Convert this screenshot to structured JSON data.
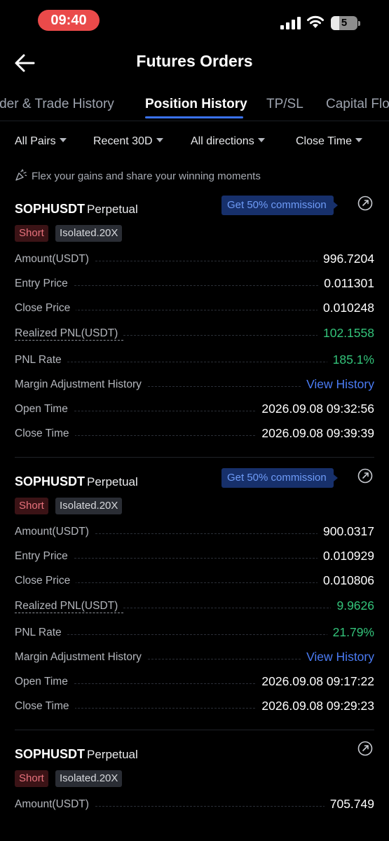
{
  "status_bar": {
    "time": "09:40",
    "battery": "5"
  },
  "header": {
    "title": "Futures Orders"
  },
  "tabs": [
    {
      "label": "Order & Trade History"
    },
    {
      "label": "Position History"
    },
    {
      "label": "TP/SL"
    },
    {
      "label": "Capital Flow"
    }
  ],
  "filters": [
    {
      "label": "All Pairs"
    },
    {
      "label": "Recent 30D"
    },
    {
      "label": "All directions"
    },
    {
      "label": "Close Time"
    }
  ],
  "banner": {
    "text": "Flex your gains and share your winning moments"
  },
  "labels": {
    "amount": "Amount(USDT)",
    "entry_price": "Entry Price",
    "close_price": "Close Price",
    "realized_pnl": "Realized PNL(USDT)",
    "pnl_rate": "PNL Rate",
    "margin_history": "Margin Adjustment History",
    "open_time": "Open Time",
    "close_time": "Close Time",
    "view_history": "View History",
    "commission": "Get 50% commission"
  },
  "positions": [
    {
      "symbol": "SOPHUSDT",
      "kind": "Perpetual",
      "direction": "Short",
      "mode": "Isolated.20X",
      "amount": "996.7204",
      "entry_price": "0.011301",
      "close_price": "0.010248",
      "realized_pnl": "102.1558",
      "pnl_rate": "185.1%",
      "open_time": "2026.09.08 09:32:56",
      "close_time": "2026.09.08 09:39:39"
    },
    {
      "symbol": "SOPHUSDT",
      "kind": "Perpetual",
      "direction": "Short",
      "mode": "Isolated.20X",
      "amount": "900.0317",
      "entry_price": "0.010929",
      "close_price": "0.010806",
      "realized_pnl": "9.9626",
      "pnl_rate": "21.79%",
      "open_time": "2026.09.08 09:17:22",
      "close_time": "2026.09.08 09:29:23"
    },
    {
      "symbol": "SOPHUSDT",
      "kind": "Perpetual",
      "direction": "Short",
      "mode": "Isolated.20X",
      "amount": "705.749"
    }
  ]
}
